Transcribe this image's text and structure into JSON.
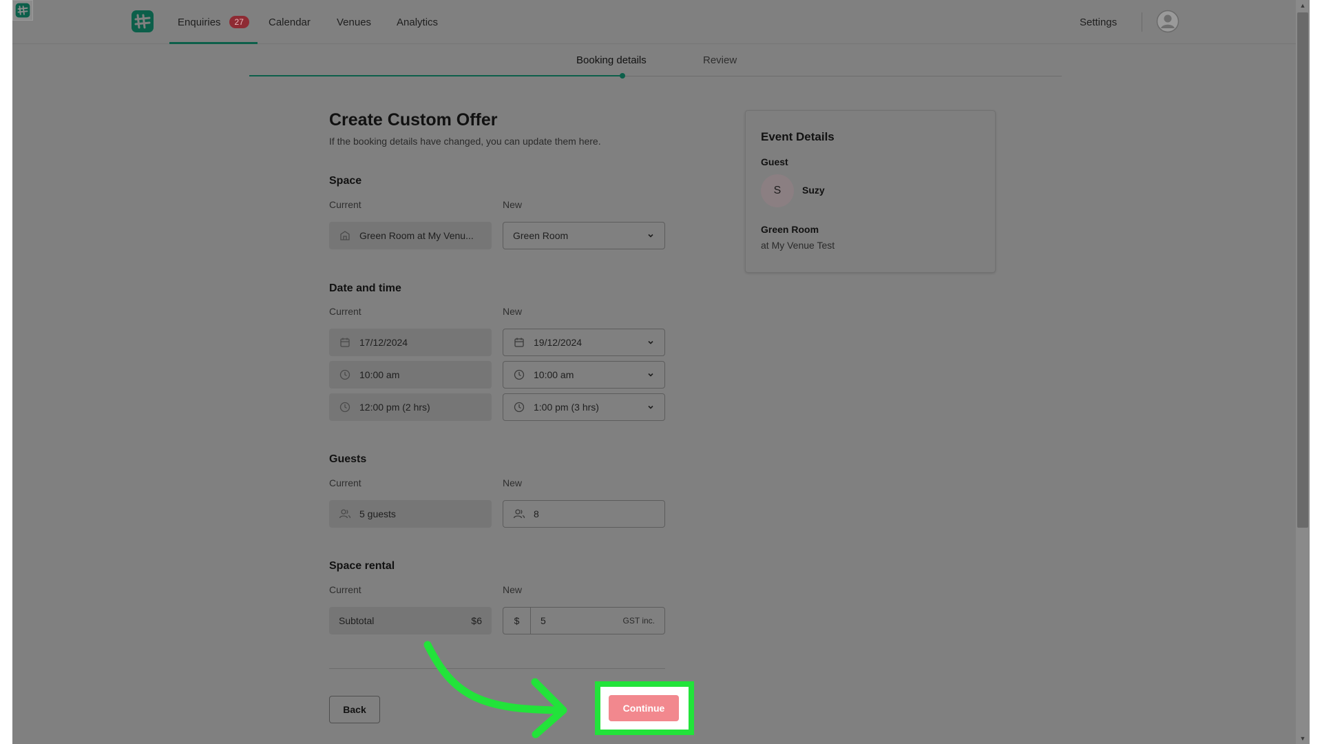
{
  "nav": {
    "items": [
      {
        "label": "Enquiries",
        "badge": "27"
      },
      {
        "label": "Calendar"
      },
      {
        "label": "Venues"
      },
      {
        "label": "Analytics"
      }
    ],
    "settings_label": "Settings"
  },
  "stepper": {
    "steps": [
      "Booking details",
      "Review"
    ],
    "active_step": 0
  },
  "form": {
    "title": "Create Custom Offer",
    "subtitle": "If the booking details have changed, you can update them here.",
    "current_label": "Current",
    "new_label": "New",
    "space": {
      "title": "Space",
      "current": "Green Room at My Venu...",
      "new": "Green Room"
    },
    "datetime": {
      "title": "Date and time",
      "current_date": "17/12/2024",
      "new_date": "19/12/2024",
      "current_start": "10:00 am",
      "new_start": "10:00 am",
      "current_end": "12:00 pm (2 hrs)",
      "new_end": "1:00 pm (3 hrs)"
    },
    "guests": {
      "title": "Guests",
      "current": "5 guests",
      "new": "8"
    },
    "space_rental": {
      "title": "Space rental",
      "subtotal_label": "Subtotal",
      "subtotal_value": "$6",
      "currency_symbol": "$",
      "new_price": "5",
      "tax_note": "GST inc."
    },
    "back_label": "Back",
    "continue_label": "Continue"
  },
  "event_details": {
    "title": "Event Details",
    "guest_label": "Guest",
    "guest_initial": "S",
    "guest_name": "Suzy",
    "space_name": "Green Room",
    "venue": "at My Venue Test"
  },
  "colors": {
    "brand_green": "#0c5f4a",
    "badge_red": "#8e2a33",
    "continue_pink": "#f2888e",
    "highlight_green": "#22e33a"
  },
  "icons": [
    "brand-logo-icon",
    "user-avatar-icon",
    "building-icon",
    "calendar-icon",
    "clock-icon",
    "users-icon",
    "chevron-down-icon",
    "arrow-annotation-icon"
  ]
}
